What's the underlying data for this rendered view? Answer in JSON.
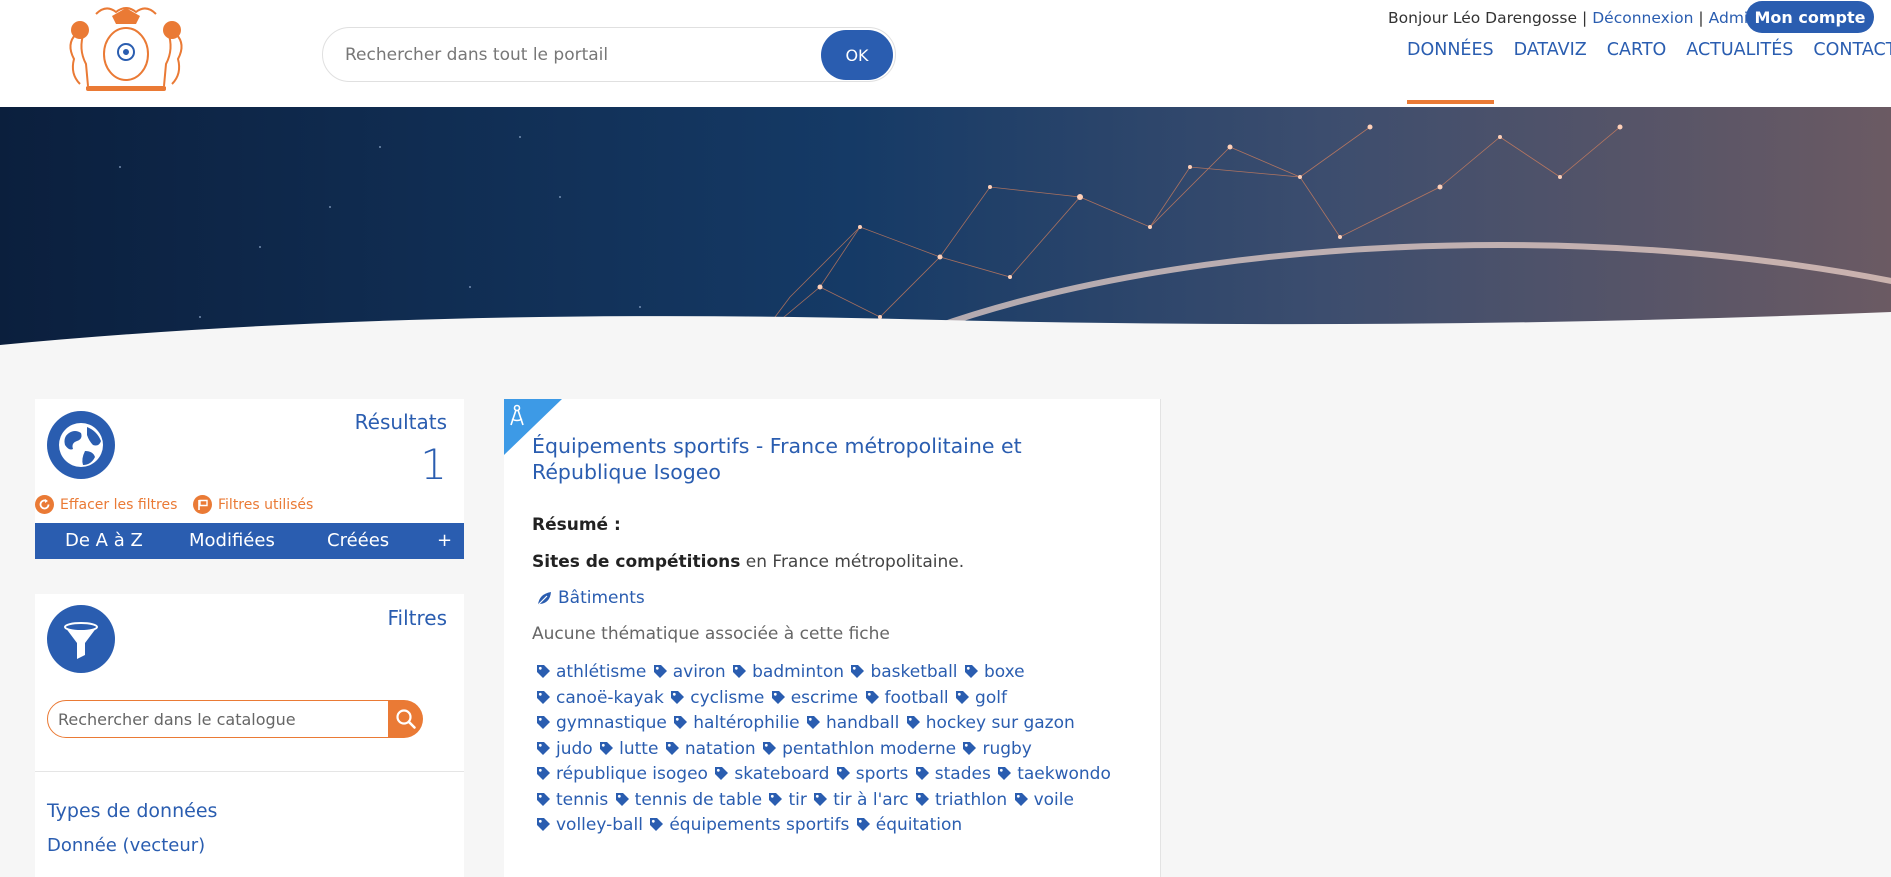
{
  "colors": {
    "primary": "#2a5db0",
    "accent": "#ea7a35",
    "background": "#f6f6f6"
  },
  "header": {
    "search_placeholder": "Rechercher dans tout le portail",
    "search_button": "OK",
    "greeting": "Bonjour Léo Darengosse",
    "logout": "Déconnexion",
    "admin": "Admin",
    "account_button": "Mon compte",
    "nav": [
      "DONNÉES",
      "DATAVIZ",
      "CARTO",
      "ACTUALITÉS",
      "CONTACT"
    ],
    "active_nav": "DONNÉES"
  },
  "results_panel": {
    "title": "Résultats",
    "count": "1",
    "clear_filters": "Effacer les filtres",
    "used_filters": "Filtres utilisés",
    "sort": {
      "az": "De A à Z",
      "modified": "Modifiées",
      "created": "Créées",
      "more": "+"
    },
    "icon": "globe-icon"
  },
  "filters_panel": {
    "title": "Filtres",
    "search_placeholder": "Rechercher dans le catalogue",
    "types_title": "Types de données",
    "types_item": "Donnée (vecteur)",
    "icon": "funnel-icon"
  },
  "result": {
    "title": "Équipements sportifs - France métropolitaine et République Isogeo",
    "resume_label": "Résumé :",
    "resume_bold": "Sites de compétitions",
    "resume_rest": " en France métropolitaine.",
    "category": "Bâtiments",
    "no_theme": "Aucune thématique associée à cette fiche",
    "keywords": [
      "athlétisme",
      "aviron",
      "badminton",
      "basketball",
      "boxe",
      "canoë-kayak",
      "cyclisme",
      "escrime",
      "football",
      "golf",
      "gymnastique",
      "haltérophilie",
      "handball",
      "hockey sur gazon",
      "judo",
      "lutte",
      "natation",
      "pentathlon moderne",
      "rugby",
      "république isogeo",
      "skateboard",
      "sports",
      "stades",
      "taekwondo",
      "tennis",
      "tennis de table",
      "tir",
      "tir à l'arc",
      "triathlon",
      "voile",
      "volley-ball",
      "équipements sportifs",
      "équitation"
    ]
  }
}
